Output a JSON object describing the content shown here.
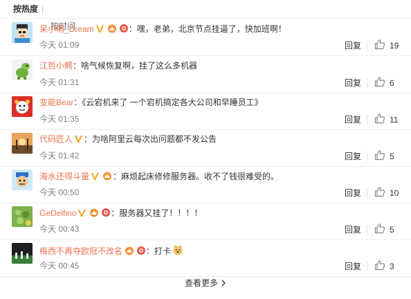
{
  "tabs": {
    "hot": "按热度",
    "separator": "|",
    "time": "按时间"
  },
  "comments": [
    {
      "user": "呆小萌_Dream",
      "badges": [
        "v",
        "vip",
        "fans"
      ],
      "text": "：嘿，老弟，北京节点挂逼了，快加班啊！",
      "time": "今天 01:09",
      "likes": "19"
    },
    {
      "user": "江哲小鳄",
      "badges": [],
      "text": "：啥气候恢复啊，挂了这么多机器",
      "time": "今天 01:31",
      "likes": "6"
    },
    {
      "user": "变能Bear",
      "badges": [],
      "text": "：《云宕机来了 一个宕机搞定各大公司和早睡员工》",
      "time": "今天 01:35",
      "likes": "11"
    },
    {
      "user": "代码匠人",
      "badges": [
        "v"
      ],
      "text": "：为啥阿里云每次出问题都不发公告",
      "time": "今天 01:42",
      "likes": "5"
    },
    {
      "user": "海水还得斗量",
      "badges": [
        "v",
        "vip"
      ],
      "text": "：麻烦起床修修服务器。收不了钱很难受的。",
      "time": "今天 00:50",
      "likes": "10"
    },
    {
      "user": "GeDelfino",
      "badges": [
        "v",
        "vip",
        "fans"
      ],
      "text": "：服务器又挂了！！！！",
      "time": "今天 00:43",
      "likes": "5"
    },
    {
      "user": "梅西不再夺欧冠不改名",
      "badges": [
        "vip",
        "fans"
      ],
      "text": "：打卡",
      "emoji": "dog",
      "time": "今天 00:45",
      "likes": "3"
    }
  ],
  "reply_label": "回复",
  "more_label": "查看更多",
  "colors": {
    "username": "#eb7350",
    "vbadge": "#f6a623",
    "time": "#808080"
  }
}
